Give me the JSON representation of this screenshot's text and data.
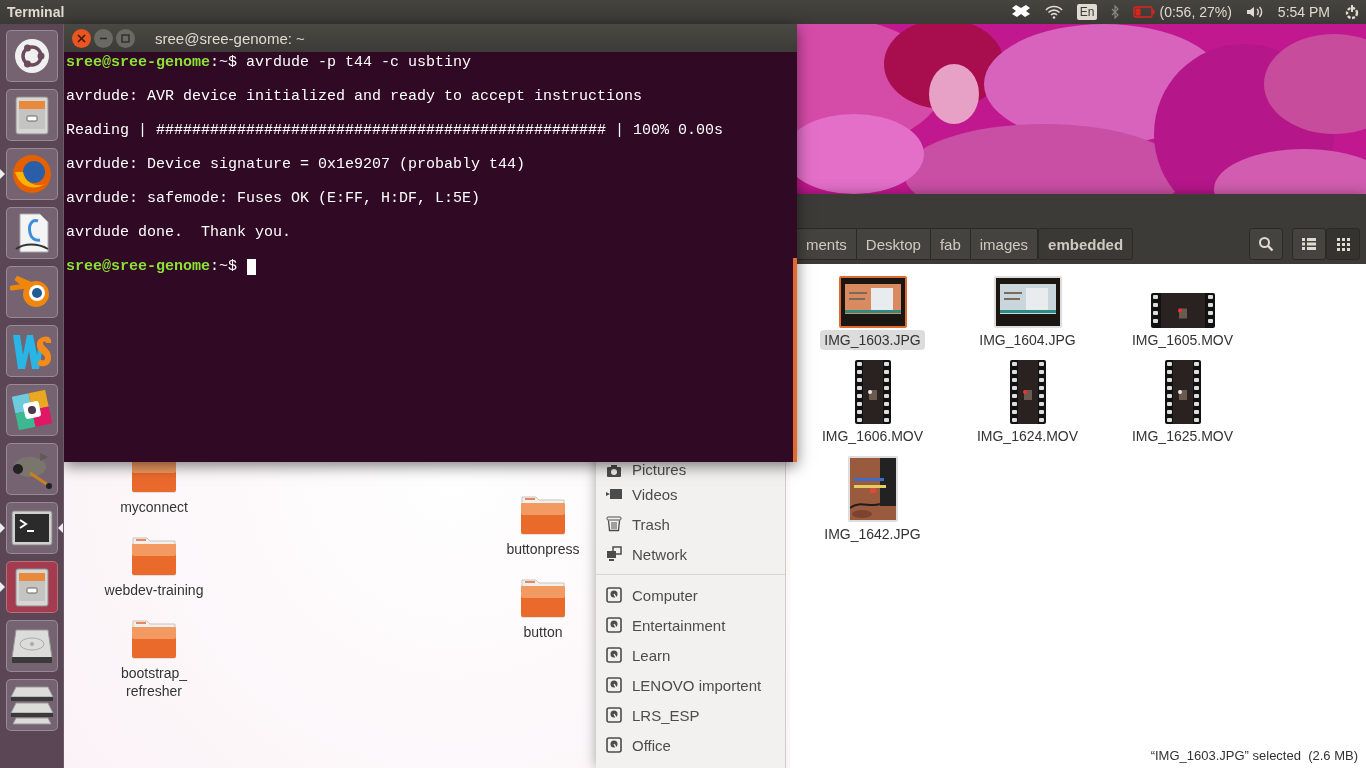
{
  "top_panel": {
    "app_title": "Terminal",
    "keyboard_layout": "En",
    "battery_low": true,
    "battery": "(0:56, 27%)",
    "clock": "5:54 PM"
  },
  "launcher": [
    {
      "kind": "ubuntu",
      "running": false,
      "focused": false,
      "highlighted": false
    },
    {
      "kind": "files",
      "running": false,
      "focused": false,
      "highlighted": false
    },
    {
      "kind": "browser",
      "running": true,
      "focused": false,
      "highlighted": false
    },
    {
      "kind": "writer",
      "running": false,
      "focused": false,
      "highlighted": false
    },
    {
      "kind": "blender",
      "running": false,
      "focused": false,
      "highlighted": false
    },
    {
      "kind": "ide",
      "running": false,
      "focused": false,
      "highlighted": false
    },
    {
      "kind": "chat",
      "running": false,
      "focused": false,
      "highlighted": false
    },
    {
      "kind": "paint",
      "running": false,
      "focused": false,
      "highlighted": false
    },
    {
      "kind": "terminal",
      "running": true,
      "focused": true,
      "highlighted": false
    },
    {
      "kind": "files",
      "running": true,
      "focused": false,
      "highlighted": true
    },
    {
      "kind": "drive",
      "running": false,
      "focused": false,
      "highlighted": false
    },
    {
      "kind": "drive_stack",
      "running": false,
      "focused": false,
      "highlighted": false
    }
  ],
  "terminal": {
    "title": "sree@sree-genome: ~",
    "lines": [
      {
        "kind": "prompt",
        "user": "sree@sree-genome",
        "path": ":~$",
        "command": "avrdude -p t44 -c usbtiny"
      },
      {
        "kind": "output",
        "text": "avrdude: AVR device initialized and ready to accept instructions"
      },
      {
        "kind": "output",
        "text": "Reading | ################################################## | 100% 0.00s"
      },
      {
        "kind": "output",
        "text": "avrdude: Device signature = 0x1e9207 (probably t44)"
      },
      {
        "kind": "output",
        "text": "avrdude: safemode: Fuses OK (E:FF, H:DF, L:5E)"
      },
      {
        "kind": "output",
        "text": "avrdude done.  Thank you."
      },
      {
        "kind": "prompt",
        "user": "sree@sree-genome",
        "path": ":~$",
        "cursor": true
      }
    ]
  },
  "desktop": {
    "columns": [
      {
        "icons": [
          {
            "lines": [
              "myconnect"
            ]
          },
          {
            "lines": [
              "webdev-training"
            ]
          },
          {
            "lines": [
              "bootstrap_",
              "refresher"
            ]
          }
        ]
      },
      {
        "icons": [
          {
            "lines": [
              "buttonpress"
            ]
          },
          {
            "lines": [
              "button"
            ]
          }
        ]
      }
    ]
  },
  "files": {
    "path": [
      {
        "label": "ments",
        "selected": false
      },
      {
        "label": "Desktop",
        "selected": false
      },
      {
        "label": "fab",
        "selected": false
      },
      {
        "label": "images",
        "selected": false
      },
      {
        "label": "embedded",
        "selected": true
      }
    ],
    "view_buttons": [
      {
        "kind": "list",
        "selected": false
      },
      {
        "kind": "grid",
        "selected": true
      }
    ],
    "sidebar": {
      "sections": [
        {
          "items": [
            {
              "kind": "camera",
              "label": "Pictures"
            },
            {
              "kind": "video",
              "label": "Videos"
            },
            {
              "kind": "trash",
              "label": "Trash"
            },
            {
              "kind": "network",
              "label": "Network"
            }
          ]
        },
        {
          "items": [
            {
              "kind": "drive",
              "label": "Computer"
            },
            {
              "kind": "drive",
              "label": "Entertainment"
            },
            {
              "kind": "drive",
              "label": "Learn"
            },
            {
              "kind": "drive",
              "label": "LENOVO importent"
            },
            {
              "kind": "drive",
              "label": "LRS_ESP"
            },
            {
              "kind": "drive",
              "label": "Office"
            }
          ]
        }
      ]
    },
    "items": [
      {
        "name": "IMG_1603.JPG",
        "selected": true
      },
      {
        "name": "IMG_1604.JPG",
        "selected": false
      },
      {
        "name": "IMG_1605.MOV",
        "kind": "video",
        "selected": false
      },
      {
        "name": "IMG_1606.MOV",
        "kind": "tallvideo",
        "selected": false
      },
      {
        "name": "IMG_1624.MOV",
        "kind": "tallvideo",
        "selected": false
      },
      {
        "name": "IMG_1625.MOV",
        "kind": "tallvideo",
        "selected": false
      },
      {
        "name": "IMG_1642.JPG",
        "kind": "tallphoto",
        "selected": false
      }
    ],
    "status": "“IMG_1603.JPG” selected  (2.6 MB)"
  }
}
